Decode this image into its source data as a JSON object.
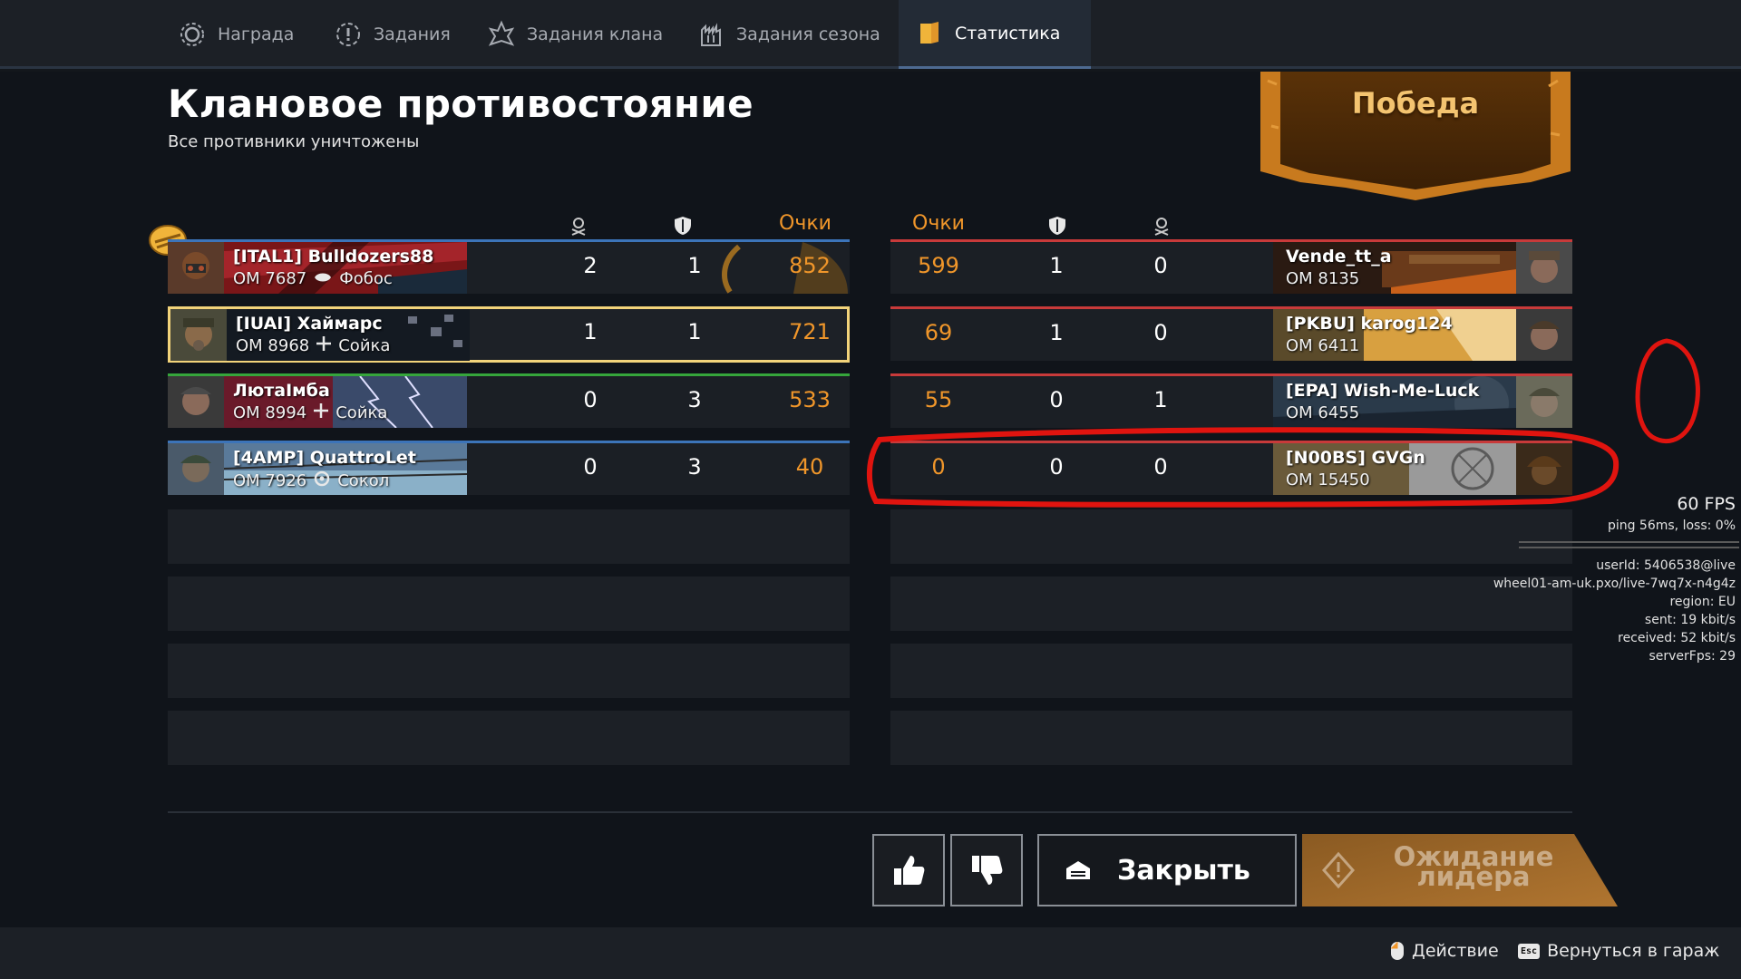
{
  "tabs": [
    {
      "label": "Награда",
      "icon": "reward-gear-icon"
    },
    {
      "label": "Задания",
      "icon": "missions-alert-icon"
    },
    {
      "label": "Задания клана",
      "icon": "clan-missions-flame-icon"
    },
    {
      "label": "Задания сезона",
      "icon": "season-missions-castle-icon"
    },
    {
      "label": "Статистика",
      "icon": "statistics-book-icon"
    }
  ],
  "header": {
    "title": "Клановое противостояние",
    "subtitle": "Все противники уничтожены",
    "result": "Победа"
  },
  "columns": {
    "points": "Очки",
    "kills_icon": "skull-crossed-icon",
    "assists_icon": "shield-icon"
  },
  "team_left": [
    {
      "name": "[ITAL1] Bulldozers88",
      "om": "ОМ 7687",
      "vehicle": "Фобос",
      "kills": "2",
      "assists": "1",
      "points": "852",
      "accent": "#3c74b9"
    },
    {
      "name": "[IUAI] Хаймарс",
      "om": "ОМ 8968",
      "vehicle": "Сойка",
      "kills": "1",
      "assists": "1",
      "points": "721",
      "accent": "#f2d37a"
    },
    {
      "name": "ЛютаІмба",
      "om": "ОМ 8994",
      "vehicle": "Сойка",
      "kills": "0",
      "assists": "3",
      "points": "533",
      "accent": "#35a53b"
    },
    {
      "name": "[4AMP] QuattroLet",
      "om": "ОМ 7926",
      "vehicle": "Сокол",
      "kills": "0",
      "assists": "3",
      "points": "40",
      "accent": "#3c74b9"
    }
  ],
  "team_right": [
    {
      "name": "Vende_tt_a",
      "om": "ОМ 8135",
      "points": "599",
      "assists": "1",
      "kills": "0"
    },
    {
      "name": "[PKBU] karog124",
      "om": "ОМ 6411",
      "points": "69",
      "assists": "1",
      "kills": "0"
    },
    {
      "name": "[EPA] Wish-Me-Luck",
      "om": "ОМ 6455",
      "points": "55",
      "assists": "0",
      "kills": "1"
    },
    {
      "name": "[N00BS] GVGn",
      "om": "ОМ 15450",
      "points": "0",
      "assists": "0",
      "kills": "0"
    }
  ],
  "buttons": {
    "like_icon": "thumbs-up-icon",
    "dislike_icon": "thumbs-down-icon",
    "close": "Закрыть",
    "wait_line1": "Ожидание",
    "wait_line2": "лидера"
  },
  "footer": {
    "action": "Действие",
    "back": "Вернуться в гараж",
    "back_key": "Esc"
  },
  "debug": {
    "fps": "60 FPS",
    "ping": "ping 56ms, loss:  0%",
    "user": "userId: 5406538@live",
    "server": "wheel01-am-uk.pxo/live-7wq7x-n4g4z",
    "region": "region: EU",
    "sent": "sent: 19 kbit/s",
    "received": "received: 52 kbit/s",
    "serverfps": "serverFps: 29"
  },
  "colors": {
    "accent_orange": "#f0962a",
    "red_team": "#c83a3a",
    "annotation_red": "#e0140f"
  }
}
